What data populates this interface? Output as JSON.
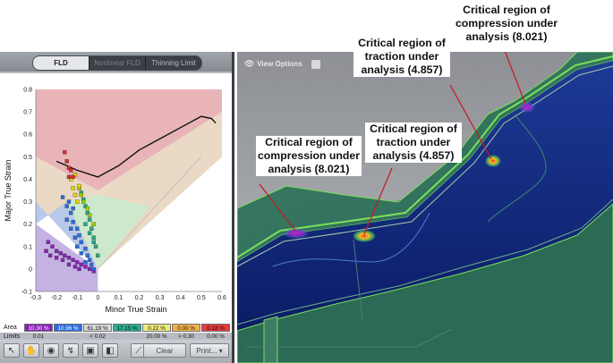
{
  "fld_panel": {
    "tabs": [
      {
        "label": "FLD",
        "state": "active"
      },
      {
        "label": "Nonlinear FLD",
        "state": "disabled"
      },
      {
        "label": "Thinning Limit",
        "state": "normal"
      }
    ],
    "chart_data": {
      "type": "scatter",
      "xlabel": "Minor True Strain",
      "ylabel": "Major True Strain",
      "xlim": [
        -0.3,
        0.6
      ],
      "ylim": [
        -0.1,
        0.8
      ],
      "x_ticks": [
        "-0.3",
        "-0.2",
        "-0.1",
        "0",
        "0.1",
        "0.2",
        "0.3",
        "0.4",
        "0.5",
        "0.6"
      ],
      "y_ticks": [
        "-0.1",
        "0",
        "0.1",
        "0.2",
        "0.3",
        "0.4",
        "0.5",
        "0.6",
        "0.7",
        "0.8"
      ],
      "flc_curve": {
        "x": [
          -0.2,
          -0.1,
          0.0,
          0.1,
          0.2,
          0.3,
          0.4,
          0.5,
          0.55,
          0.57
        ],
        "y": [
          0.48,
          0.44,
          0.41,
          0.46,
          0.53,
          0.58,
          0.63,
          0.68,
          0.67,
          0.65
        ]
      },
      "zone_colors": {
        "crack": "#e8b4b8",
        "risk": "#ead9c4",
        "safe": "#cde9cd",
        "compress": "#c4b2e2",
        "thicken": "#b7c8e8"
      },
      "point_series": [
        {
          "color": "#8a22b8",
          "points": [
            [
              -0.24,
              0.12
            ],
            [
              -0.22,
              0.1
            ],
            [
              -0.2,
              0.08
            ],
            [
              -0.18,
              0.07
            ],
            [
              -0.16,
              0.06
            ],
            [
              -0.14,
              0.05
            ],
            [
              -0.12,
              0.04
            ],
            [
              -0.1,
              0.03
            ],
            [
              -0.08,
              0.02
            ],
            [
              -0.06,
              0.01
            ],
            [
              -0.04,
              0.0
            ],
            [
              -0.02,
              -0.01
            ],
            [
              -0.25,
              0.08
            ],
            [
              -0.23,
              0.06
            ],
            [
              -0.2,
              0.05
            ],
            [
              -0.17,
              0.04
            ],
            [
              -0.14,
              0.02
            ],
            [
              -0.11,
              0.01
            ],
            [
              -0.09,
              0.0
            ]
          ]
        },
        {
          "color": "#2a6de0",
          "points": [
            [
              -0.17,
              0.32
            ],
            [
              -0.15,
              0.28
            ],
            [
              -0.13,
              0.25
            ],
            [
              -0.12,
              0.21
            ],
            [
              -0.1,
              0.18
            ],
            [
              -0.09,
              0.15
            ],
            [
              -0.08,
              0.12
            ],
            [
              -0.06,
              0.09
            ],
            [
              -0.05,
              0.06
            ],
            [
              -0.04,
              0.04
            ],
            [
              -0.03,
              0.02
            ],
            [
              -0.02,
              0.0
            ],
            [
              -0.15,
              0.22
            ],
            [
              -0.13,
              0.18
            ],
            [
              -0.11,
              0.14
            ],
            [
              -0.1,
              0.1
            ],
            [
              -0.08,
              0.07
            ],
            [
              -0.06,
              0.03
            ],
            [
              -0.14,
              0.3
            ],
            [
              -0.12,
              0.27
            ]
          ]
        },
        {
          "color": "#28a888",
          "points": [
            [
              -0.08,
              0.34
            ],
            [
              -0.07,
              0.31
            ],
            [
              -0.06,
              0.28
            ],
            [
              -0.05,
              0.25
            ],
            [
              -0.04,
              0.22
            ],
            [
              -0.03,
              0.18
            ],
            [
              -0.02,
              0.14
            ],
            [
              -0.01,
              0.1
            ],
            [
              0.0,
              0.06
            ],
            [
              -0.06,
              0.2
            ],
            [
              -0.04,
              0.16
            ],
            [
              -0.02,
              0.12
            ]
          ]
        },
        {
          "color": "#9fd000",
          "points": [
            [
              -0.09,
              0.36
            ],
            [
              -0.08,
              0.33
            ],
            [
              -0.07,
              0.3
            ],
            [
              -0.05,
              0.27
            ],
            [
              -0.04,
              0.24
            ],
            [
              -0.02,
              0.2
            ]
          ]
        },
        {
          "color": "#e8d800",
          "points": [
            [
              -0.12,
              0.36
            ],
            [
              -0.11,
              0.33
            ],
            [
              -0.1,
              0.3
            ],
            [
              -0.09,
              0.37
            ],
            [
              -0.13,
              0.4
            ],
            [
              -0.11,
              0.42
            ]
          ]
        },
        {
          "color": "#d8302c",
          "points": [
            [
              -0.16,
              0.52
            ],
            [
              -0.15,
              0.48
            ],
            [
              -0.14,
              0.45
            ],
            [
              -0.13,
              0.44
            ],
            [
              -0.14,
              0.41
            ],
            [
              -0.12,
              0.41
            ]
          ]
        }
      ]
    },
    "legend": {
      "row_labels": {
        "area": "Area",
        "limits": "Limits"
      },
      "cells": [
        {
          "area": "10.30 %",
          "limit": "0.01",
          "color": "#8a22b8",
          "text_color": "#ffffff"
        },
        {
          "area": "10.96 %",
          "limit": "",
          "color": "#2a6de0",
          "text_color": "#ffffff"
        },
        {
          "area": "61.19 %",
          "limit": "< 0.02",
          "color": "#d9d9d9",
          "text_color": "#111111"
        },
        {
          "area": "17.15 %",
          "limit": "",
          "color": "#26b090",
          "text_color": "#111111"
        },
        {
          "area": "0.22 %",
          "limit": "20.00 %",
          "color": "#f1ea7a",
          "text_color": "#111111"
        },
        {
          "area": "0.00 %",
          "limit": "> 0.30",
          "color": "#f3b24c",
          "text_color": "#111111"
        },
        {
          "area": "0.18 %",
          "limit": "0.00 %",
          "color": "#e23c3c",
          "text_color": "#111111"
        }
      ]
    },
    "toolbar": {
      "clear_label": "Clear",
      "print_label": "Print...",
      "tool_icons": [
        "pointer-icon",
        "hand-icon",
        "target-icon",
        "curve-icon",
        "stamp-icon",
        "eraser-icon",
        "probe-icon"
      ]
    }
  },
  "view_panel": {
    "view_options_label": "View Options"
  },
  "callouts": [
    {
      "lines": [
        "Critical region of",
        "compression under",
        "analysis (8.021)"
      ]
    },
    {
      "lines": [
        "Critical region of",
        "traction under",
        "analysis (4.857)"
      ]
    },
    {
      "lines": [
        "Critical region of",
        "traction under",
        "analysis (4.857)"
      ]
    },
    {
      "lines": [
        "Critical region of",
        "compression under",
        "analysis (8.021)"
      ]
    }
  ]
}
